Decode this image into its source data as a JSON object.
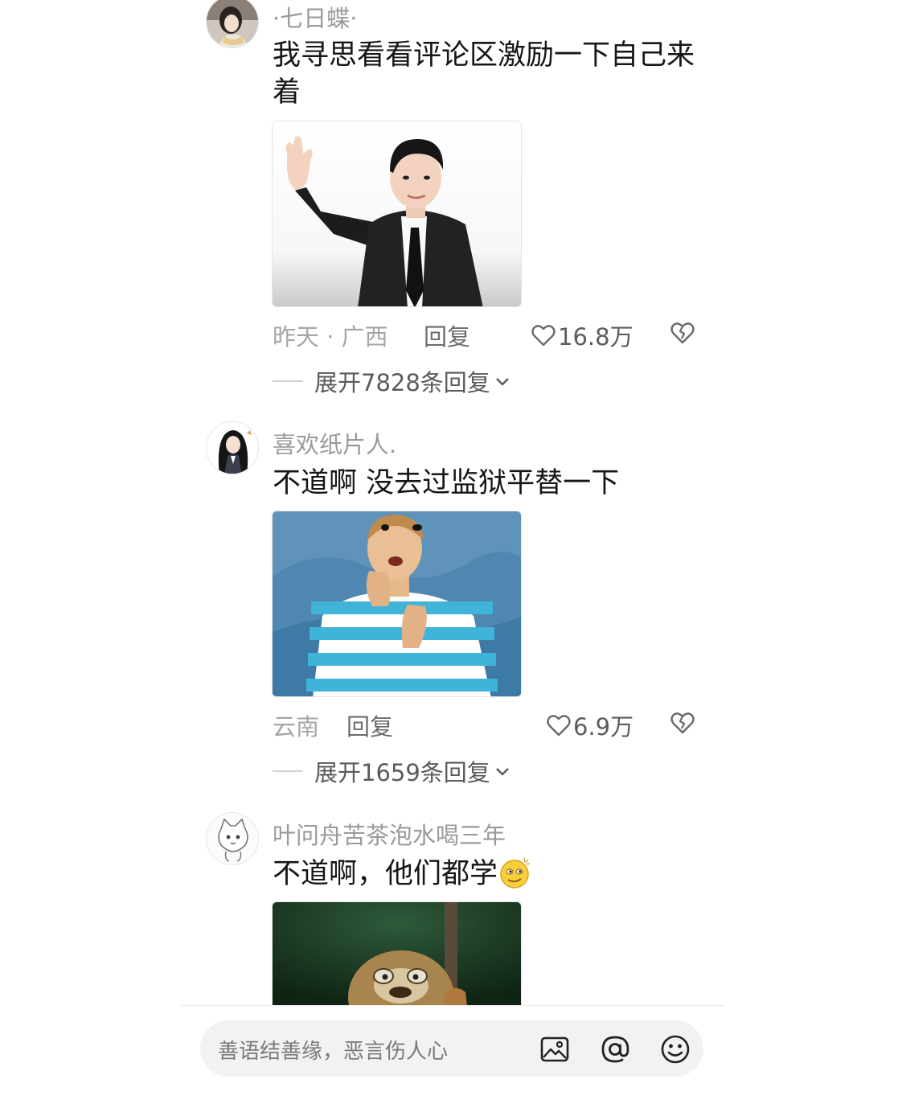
{
  "comments": [
    {
      "username": "·七日蝶·",
      "text": "我寻思看看评论区激励一下自己来着",
      "location": "昨天 · 广西",
      "reply_label": "回复",
      "likes": "16.8万",
      "expand_label": "展开7828条回复"
    },
    {
      "username": "喜欢纸片人.",
      "text": "不道啊 没去过监狱平替一下",
      "location": "云南",
      "reply_label": "回复",
      "likes": "6.9万",
      "expand_label": "展开1659条回复"
    },
    {
      "username": "叶问舟苦茶泡水喝三年",
      "text": "不道啊，他们都学",
      "emoji": "smirk-emoji"
    }
  ],
  "composer": {
    "placeholder": "善语结善缘，恶言伤人心",
    "icons": [
      "image-icon",
      "at-icon",
      "emoji-icon"
    ]
  },
  "colors": {
    "username": "#9a9a9a",
    "meta": "#a5a5a5",
    "input_bg": "#f2f2f2"
  }
}
